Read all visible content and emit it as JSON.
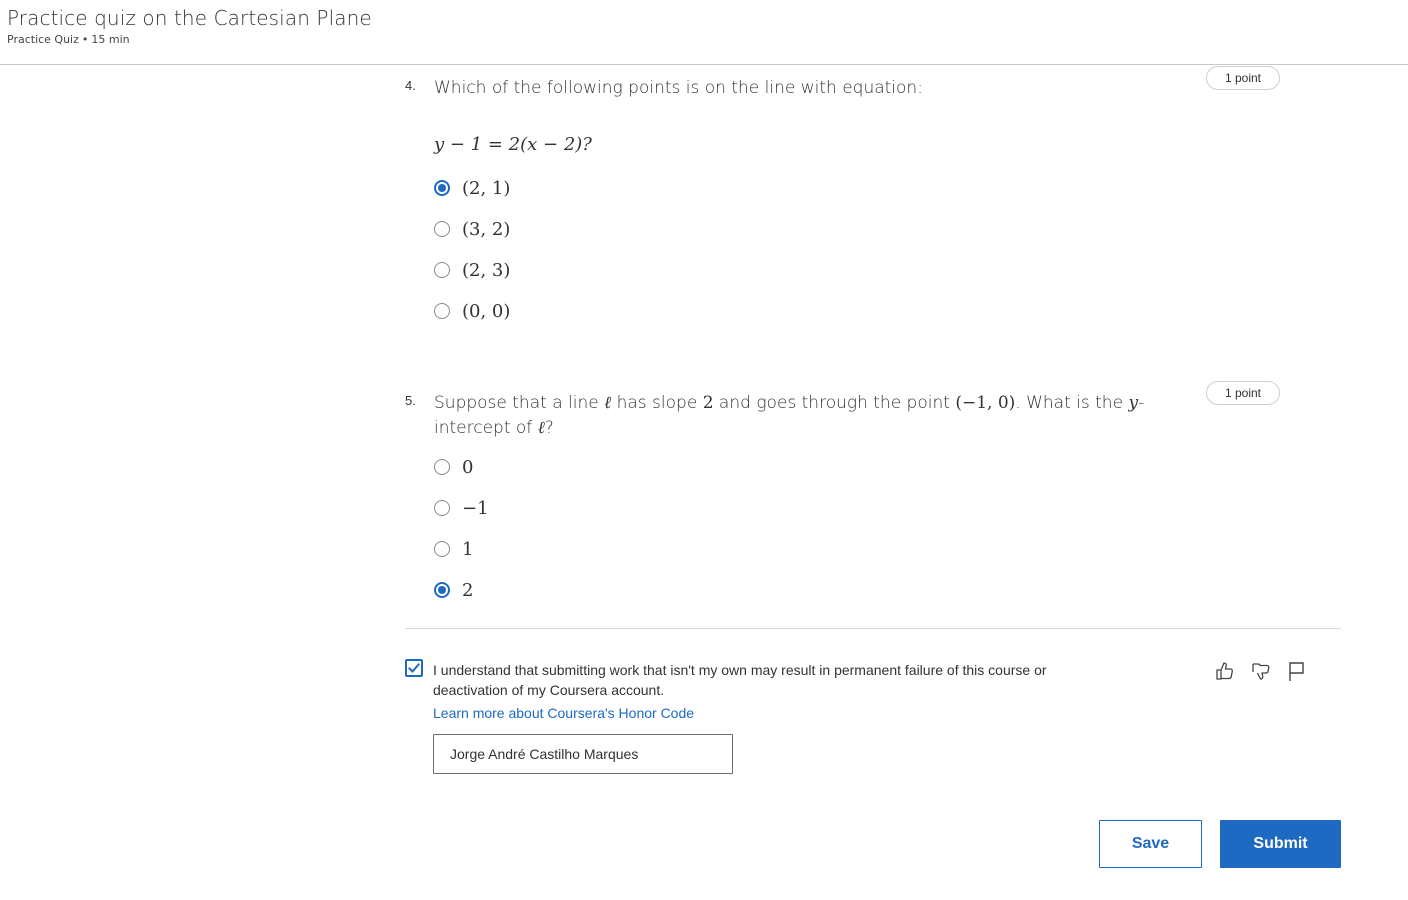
{
  "header": {
    "title": "Practice quiz on the Cartesian Plane",
    "type": "Practice Quiz",
    "separator": "•",
    "duration": "15 min"
  },
  "questions": [
    {
      "number": "4.",
      "text": "Which of the following points is on the line with equation:",
      "points": "1 point",
      "equation": "y − 1 = 2(x − 2)?",
      "options": [
        {
          "label": "(2, 1)",
          "selected": true
        },
        {
          "label": "(3, 2)",
          "selected": false
        },
        {
          "label": "(2, 3)",
          "selected": false
        },
        {
          "label": "(0, 0)",
          "selected": false
        }
      ]
    },
    {
      "number": "5.",
      "text_parts": {
        "p1": "Suppose that a line ",
        "ell": "ℓ",
        "p2": " has slope ",
        "slope": "2",
        "p3": " and goes through the point ",
        "point": "(−1, 0)",
        "p4": ". What is the ",
        "yvar": "y",
        "p5": "-intercept of ",
        "ell2": "ℓ",
        "p6": "?"
      },
      "points": "1 point",
      "options": [
        {
          "label": "0",
          "selected": false
        },
        {
          "label": "−1",
          "selected": false
        },
        {
          "label": "1",
          "selected": false
        },
        {
          "label": "2",
          "selected": true
        }
      ]
    }
  ],
  "honor": {
    "checked": true,
    "text": "I understand that submitting work that isn't my own may result in permanent failure of this course or deactivation of my Coursera account.",
    "link": "Learn more about Coursera's Honor Code",
    "name_value": "Jorge André Castilho Marques"
  },
  "actions": {
    "save": "Save",
    "submit": "Submit"
  },
  "feedback_icons": [
    "thumbs-up-icon",
    "thumbs-down-icon",
    "flag-icon"
  ],
  "colors": {
    "accent": "#1e6ac2",
    "text": "#333333",
    "border": "#c8c8c8"
  }
}
